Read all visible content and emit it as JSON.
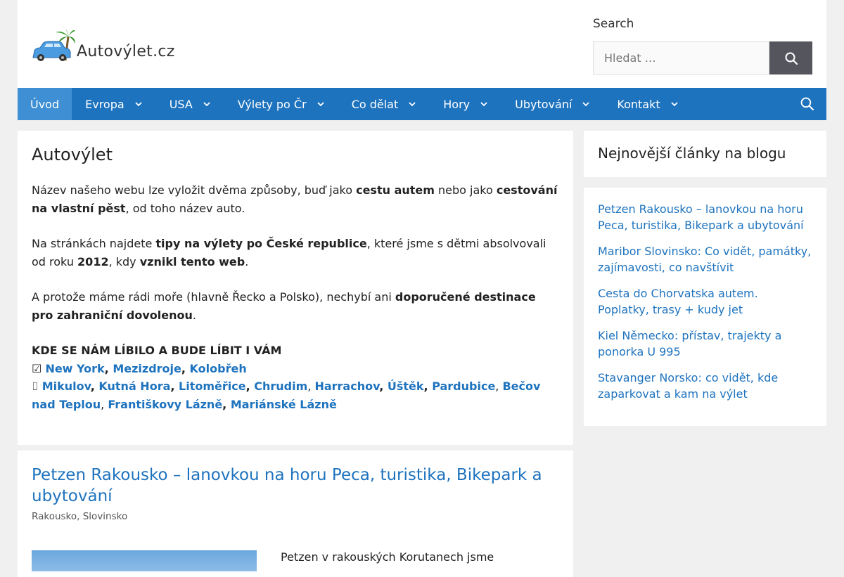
{
  "site": {
    "logo_text": "Autovýlet.cz"
  },
  "search": {
    "title": "Search",
    "placeholder": "Hledat …"
  },
  "nav": {
    "items": [
      {
        "label": "Úvod",
        "active": true,
        "has_dropdown": false
      },
      {
        "label": "Evropa",
        "has_dropdown": true
      },
      {
        "label": "USA",
        "has_dropdown": true
      },
      {
        "label": "Výlety po Čr",
        "has_dropdown": true
      },
      {
        "label": "Co dělat",
        "has_dropdown": true
      },
      {
        "label": "Hory",
        "has_dropdown": true
      },
      {
        "label": "Ubytování",
        "has_dropdown": true
      },
      {
        "label": "Kontakt",
        "has_dropdown": true
      }
    ]
  },
  "main": {
    "title": "Autovýlet",
    "p1": {
      "t1": "Název našeho webu lze vyložit dvěma způsoby, buď jako ",
      "b1": "cestu autem",
      "t2": " nebo jako ",
      "b2": "cestování na vlastní pěst",
      "t3": ", od toho název auto."
    },
    "p2": {
      "t1": "Na stránkách najdete ",
      "b1": "tipy na výlety po České republice",
      "t2": ", které jsme s dětmi absolvovali od roku ",
      "b2": "2012",
      "t3": ", kdy ",
      "b3": "vznikl tento web",
      "t4": "."
    },
    "p3": {
      "t1": "A protože máme rádi moře (hlavně Řecko a Polsko), nechybí ani ",
      "b1": "doporučené destinace pro zahraniční dovolenou",
      "t2": "."
    },
    "heading": "KDE SE NÁM LÍBILO A BUDE LÍBIT I VÁM",
    "line1_prefix": "☑ ",
    "line1_links": [
      "New York",
      "Mezizdroje",
      "Kolobřeh"
    ],
    "line2_prefix": "⌷ ",
    "line2_links": [
      "Mikulov",
      "Kutná Hora",
      "Litoměřice",
      "Chrudim",
      "Harrachov",
      "Úštěk",
      "Pardubice",
      "Bečov nad Teplou",
      "Františkovy Lázně",
      "Mariánské Lázně"
    ]
  },
  "post": {
    "title": "Petzen Rakousko – lanovkou na horu Peca, turistika, Bikepark a ubytování",
    "categories": [
      "Rakousko",
      "Slovinsko"
    ],
    "excerpt": "Petzen v rakouských Korutanech jsme"
  },
  "sidebar": {
    "title": "Nejnovější články na blogu",
    "posts": [
      "Petzen Rakousko – lanovkou na horu Peca, turistika, Bikepark a ubytování",
      "Maribor Slovinsko: Co vidět, památky, zajímavosti, co navštívit",
      "Cesta do Chorvatska autem. Poplatky, trasy + kudy jet",
      "Kiel Německo: přístav, trajekty a ponorka U 995",
      "Stavanger Norsko: co vidět, kde zaparkovat a kam na výlet"
    ]
  },
  "colors": {
    "nav_bg": "#1e73be",
    "nav_active": "#3f8fd4",
    "link": "#1e73be",
    "search_button": "#55555e"
  }
}
